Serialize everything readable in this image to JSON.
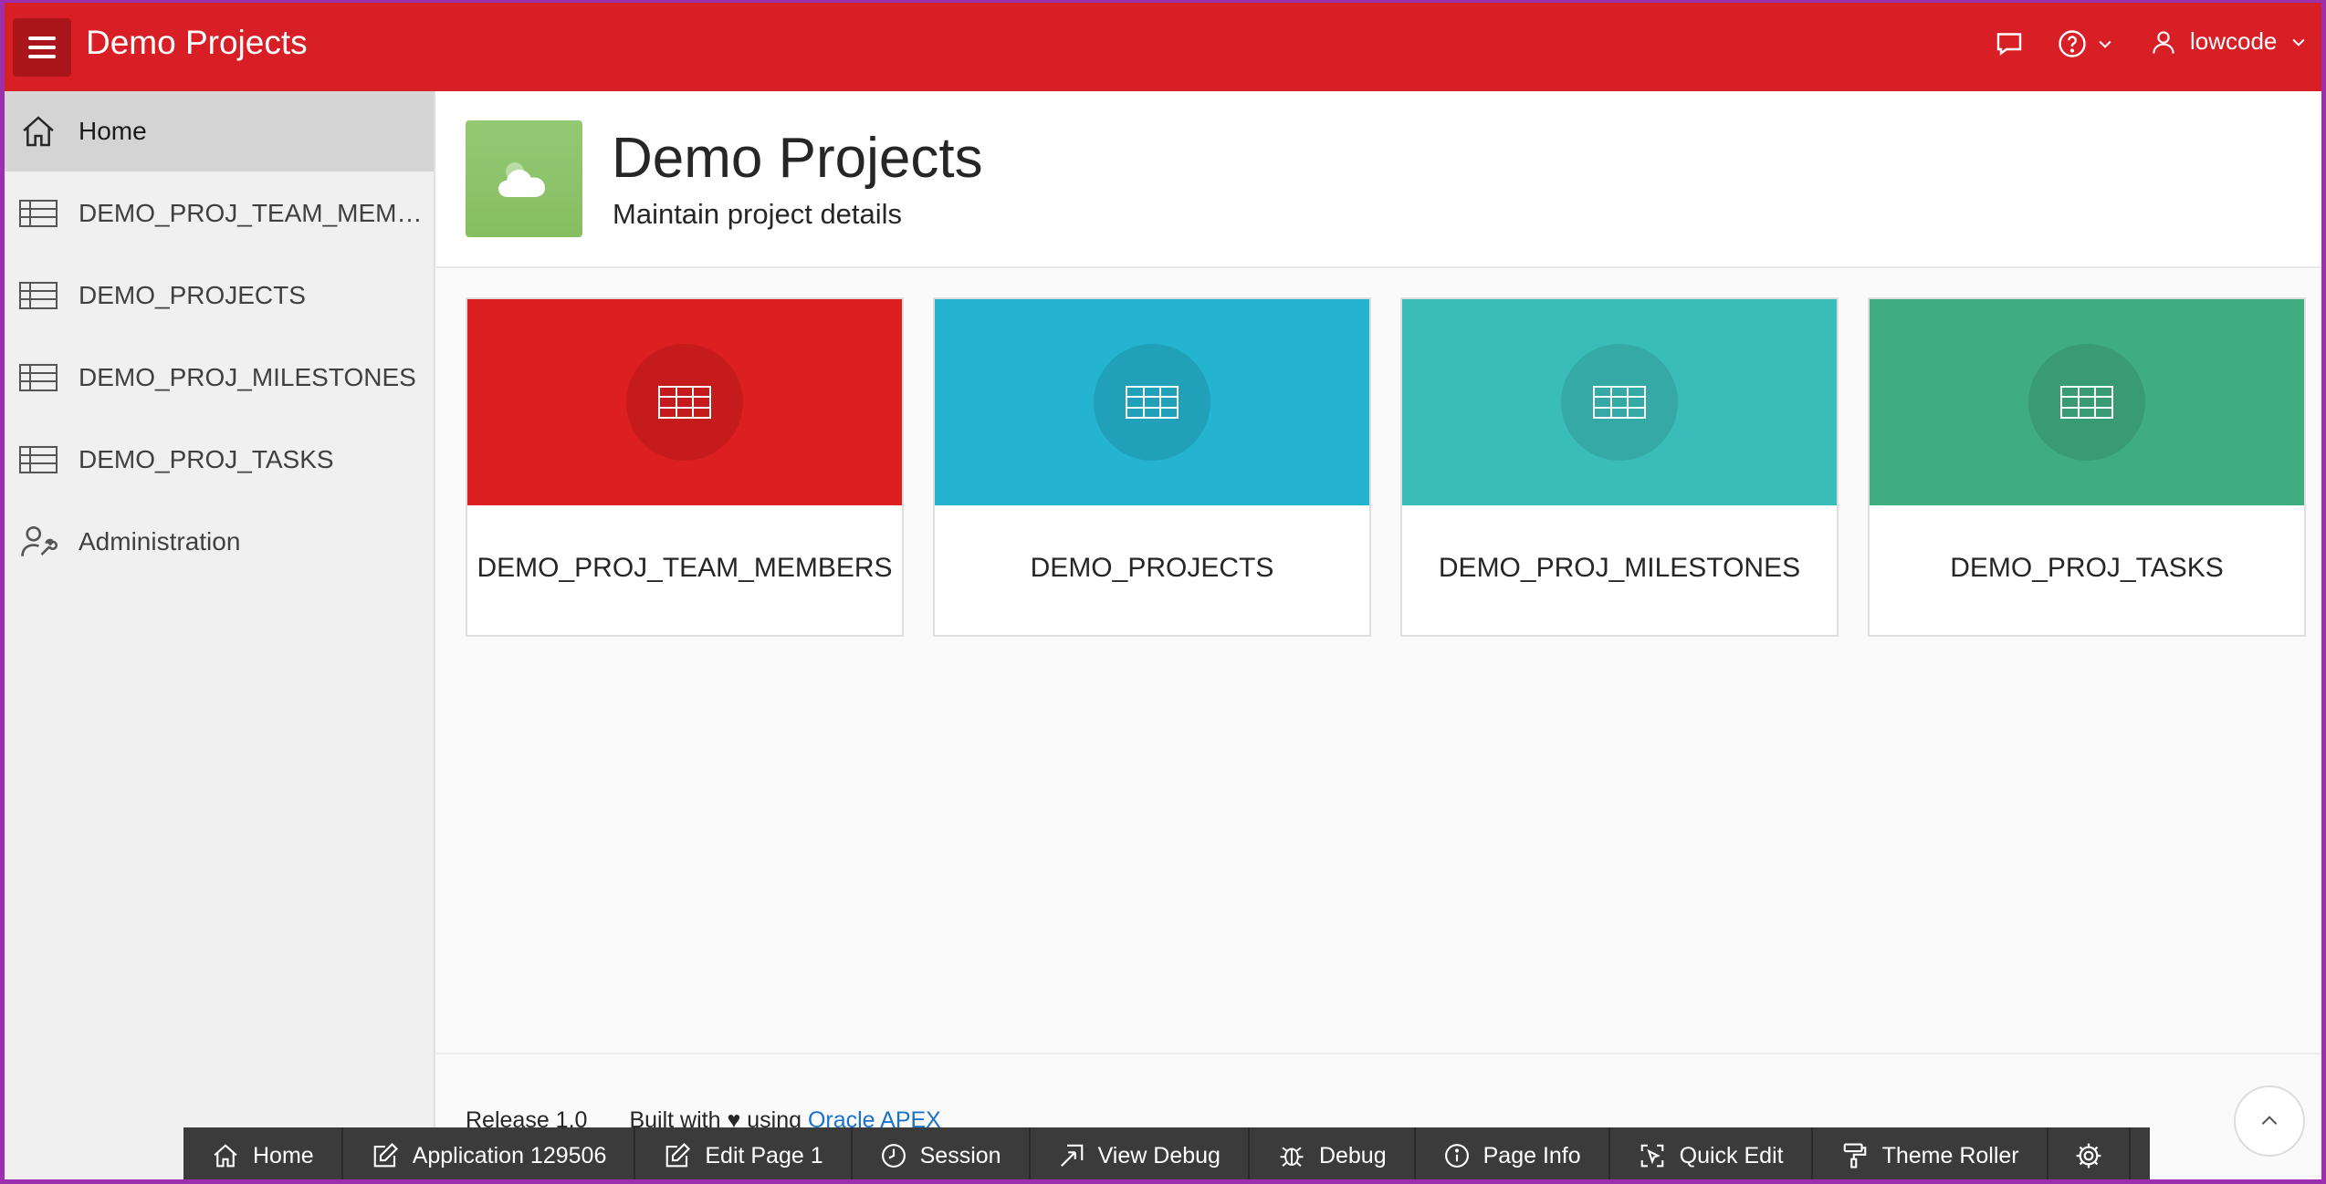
{
  "header": {
    "app_title": "Demo Projects",
    "username": "lowcode",
    "icons": [
      "menu-icon",
      "chat-icon",
      "help-icon",
      "user-icon"
    ]
  },
  "sidebar": {
    "items": [
      {
        "label": "Home",
        "icon": "home-icon",
        "active": true
      },
      {
        "label": "DEMO_PROJ_TEAM_MEMBE...",
        "icon": "table-icon"
      },
      {
        "label": "DEMO_PROJECTS",
        "icon": "table-icon"
      },
      {
        "label": "DEMO_PROJ_MILESTONES",
        "icon": "table-icon"
      },
      {
        "label": "DEMO_PROJ_TASKS",
        "icon": "table-icon"
      },
      {
        "label": "Administration",
        "icon": "user-wrench-icon"
      }
    ]
  },
  "hero": {
    "title": "Demo Projects",
    "subtitle": "Maintain project details",
    "icon": "cloud-icon",
    "color": "#8cc36a"
  },
  "cards": [
    {
      "label": "DEMO_PROJ_TEAM_MEMBERS",
      "color": "#dc1f21",
      "icon": "table-icon"
    },
    {
      "label": "DEMO_PROJECTS",
      "color": "#24b4cf",
      "icon": "table-icon"
    },
    {
      "label": "DEMO_PROJ_MILESTONES",
      "color": "#3abdb8",
      "icon": "table-icon"
    },
    {
      "label": "DEMO_PROJ_TASKS",
      "color": "#3fad80",
      "icon": "table-icon"
    }
  ],
  "footer": {
    "release": "Release 1.0",
    "built_with": "Built with",
    "using": "using",
    "link": "Oracle APEX"
  },
  "devbar": {
    "items": [
      {
        "label": "Home",
        "icon": "home-icon"
      },
      {
        "label": "Application 129506",
        "icon": "edit-icon"
      },
      {
        "label": "Edit Page 1",
        "icon": "edit-icon"
      },
      {
        "label": "Session",
        "icon": "clock-icon"
      },
      {
        "label": "View Debug",
        "icon": "view-debug-icon"
      },
      {
        "label": "Debug",
        "icon": "bug-icon"
      },
      {
        "label": "Page Info",
        "icon": "info-icon"
      },
      {
        "label": "Quick Edit",
        "icon": "quick-edit-icon"
      },
      {
        "label": "Theme Roller",
        "icon": "paint-roller-icon"
      },
      {
        "label": "",
        "icon": "gear-icon"
      }
    ]
  },
  "colors": {
    "header": "#d91f26",
    "menu_button": "#a9151b",
    "link": "#1a73c9",
    "devbar": "#3b3b3b"
  }
}
